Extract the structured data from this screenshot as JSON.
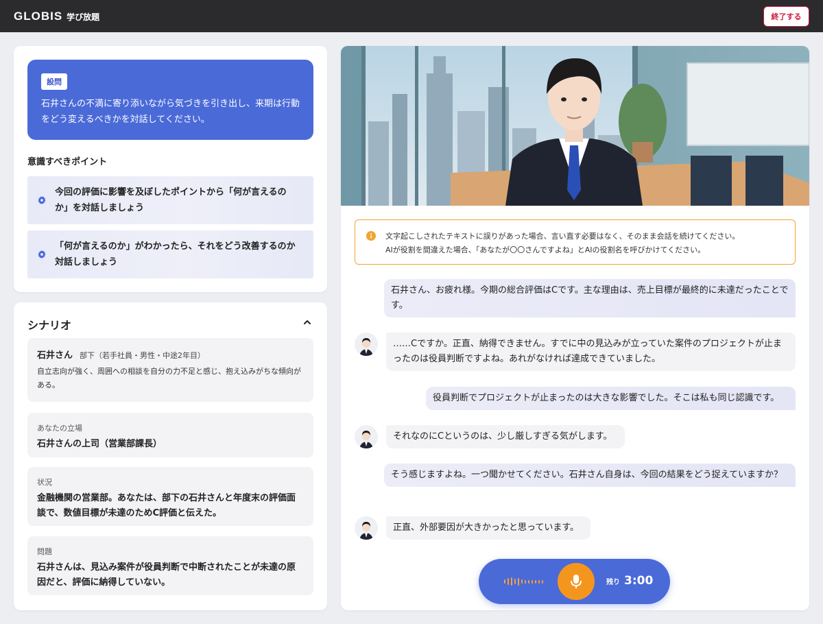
{
  "header": {
    "logo": "GLOBIS",
    "logo_sub": "学び放題",
    "end_button": "終了する"
  },
  "question": {
    "tag": "設問",
    "text": "石井さんの不満に寄り添いながら気づきを引き出し、来期は行動をどう変えるべきかを対話してください。"
  },
  "points": {
    "title": "意識すべきポイント",
    "items": [
      "今回の評価に影響を及ぼしたポイントから「何が言えるのか」を対話しましょう",
      "「何が言えるのか」がわかったら、それをどう改善するのか対話しましょう"
    ]
  },
  "scenario": {
    "title": "シナリオ",
    "person_name": "石井さん",
    "person_role": "部下（若手社員・男性・中途2年目）",
    "person_desc": "自立志向が強く、周囲への相談を自分の力不足と感じ、抱え込みがちな傾向がある。",
    "position_label": "あなたの立場",
    "position_value": "石井さんの上司（営業部課長）",
    "situation_label": "状況",
    "situation_value": "金融機関の営業部。あなたは、部下の石井さんと年度末の評価面談で、数値目標が未達のためC評価と伝えた。",
    "problem_label": "問題",
    "problem_value": "石井さんは、見込み案件が役員判断で中断されたことが未達の原因だと、評価に納得していない。"
  },
  "notice": {
    "line1": "文字起こしされたテキストに誤りがあった場合、言い直す必要はなく、そのまま会話を続けてください。",
    "line2": "AIが役割を間違えた場合、「あなたが〇〇さんですよね」とAIの役割名を呼びかけてください。"
  },
  "chat": [
    {
      "role": "user",
      "text": "石井さん、お疲れ様。今期の総合評価はCです。主な理由は、売上目標が最終的に未達だったことです。"
    },
    {
      "role": "ai",
      "text": "……Cですか。正直、納得できません。すでに中の見込みが立っていた案件のプロジェクトが止まったのは役員判断ですよね。あれがなければ達成できていました。"
    },
    {
      "role": "user",
      "text": "役員判断でプロジェクトが止まったのは大きな影響でした。そこは私も同じ認識です。"
    },
    {
      "role": "ai",
      "text": "それなのにCというのは、少し厳しすぎる気がします。"
    },
    {
      "role": "user",
      "text": "そう感じますよね。一つ聞かせてください。石井さん自身は、今回の結果をどう捉えていますか？"
    },
    {
      "role": "ai",
      "text": "正直、外部要因が大きかったと思っています。"
    }
  ],
  "recorder": {
    "remaining_label": "残り",
    "remaining_time": "3:00"
  },
  "colors": {
    "primary": "#4a6ad8",
    "accent": "#f4961e",
    "danger": "#d0193a",
    "header": "#2b2b2e"
  }
}
